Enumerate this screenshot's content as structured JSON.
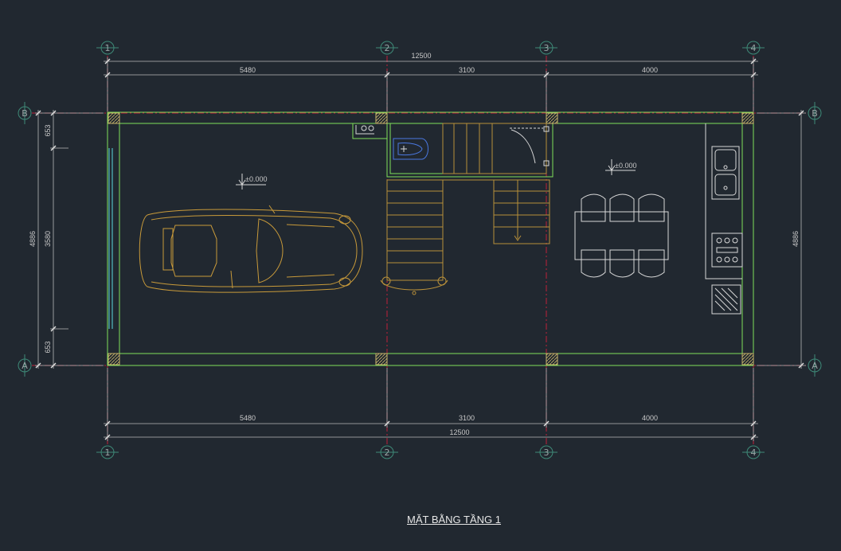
{
  "title": "MẶT BẰNG TẦNG 1",
  "colors": {
    "background": "#212830",
    "wall": "#7ee05a",
    "column_hatch": "#c8b46a",
    "grid_line": "#c0203a",
    "dimension": "#b8b8b8",
    "furniture_car": "#c89a3a",
    "stairs": "#b8903a",
    "fixtures": "#d8d8d8",
    "window": "#5ad8e0",
    "toilet": "#4a78e0"
  },
  "grid_axes": {
    "vertical": [
      "1",
      "2",
      "3",
      "4"
    ],
    "horizontal": [
      "B",
      "A"
    ]
  },
  "dimensions": {
    "top_total": "12500",
    "top_segments": [
      "5480",
      "3100",
      "4000"
    ],
    "bottom_segments": [
      "5480",
      "3100",
      "4000"
    ],
    "bottom_total": "12500",
    "left_total": "4886",
    "left_segments": [
      "653",
      "3580",
      "653"
    ],
    "right_total": "4886"
  },
  "levels": [
    "±0.000",
    "±0.000"
  ]
}
